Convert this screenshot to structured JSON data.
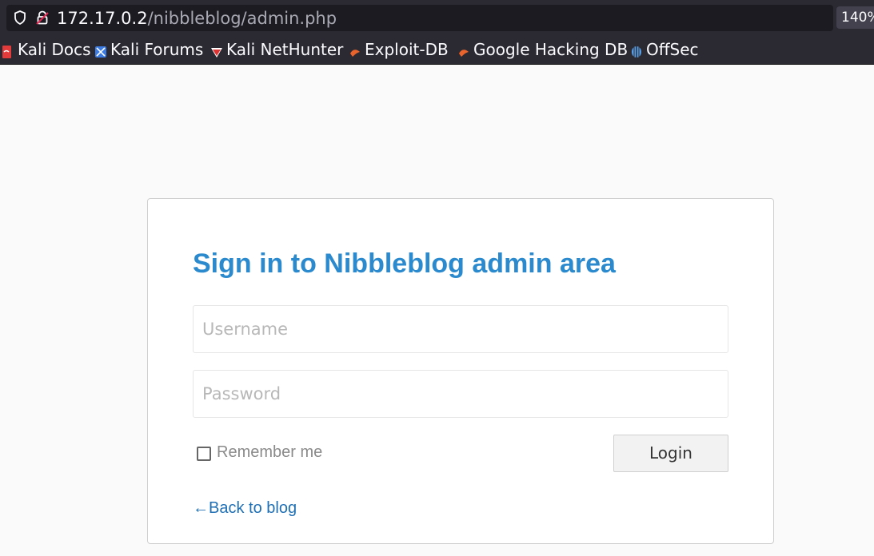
{
  "browser": {
    "url_host": "172.17.0.2",
    "url_path": "/nibbleblog/admin.php",
    "zoom": "140%",
    "bookmarks": [
      {
        "label": "Kali Docs",
        "icon": "kali-docs-icon",
        "color": "#e23b3b"
      },
      {
        "label": "Kali Forums",
        "icon": "kali-forums-icon",
        "color": "#3b7be2"
      },
      {
        "label": "Kali NetHunter",
        "icon": "kali-nethunter-icon",
        "color": "#d33"
      },
      {
        "label": "Exploit-DB",
        "icon": "exploit-db-icon",
        "color": "#e8642c"
      },
      {
        "label": "Google Hacking DB",
        "icon": "ghdb-icon",
        "color": "#e8642c"
      },
      {
        "label": "OffSec",
        "icon": "offsec-icon",
        "color": "#5aa0e8"
      }
    ]
  },
  "login": {
    "title": "Sign in to Nibbleblog admin area",
    "username_placeholder": "Username",
    "password_placeholder": "Password",
    "remember_label": "Remember me",
    "login_button": "Login",
    "back_link": "←Back to blog"
  },
  "colors": {
    "title": "#2b8acd",
    "link": "#1f6fb5",
    "chrome_bg": "#2b2a33"
  }
}
